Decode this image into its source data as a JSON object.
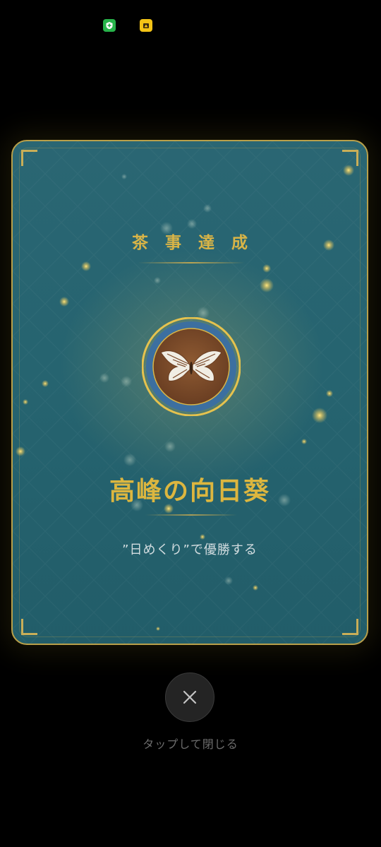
{
  "status_bar": {
    "icons": [
      "shield-app-icon",
      "yellow-app-icon"
    ]
  },
  "card": {
    "header_title": "茶事達成",
    "badge_icon": "butterfly-emblem-icon",
    "achievement_name": "高峰の向日葵",
    "achievement_description": "”日めくり”で優勝する"
  },
  "close": {
    "icon": "close-icon",
    "hint": "タップして閉じる"
  },
  "colors": {
    "card_background": "#266470",
    "gold_accent": "#d8b447",
    "badge_ring_blue": "#3b6f9e",
    "badge_fill_brown": "#7b4a2a"
  }
}
